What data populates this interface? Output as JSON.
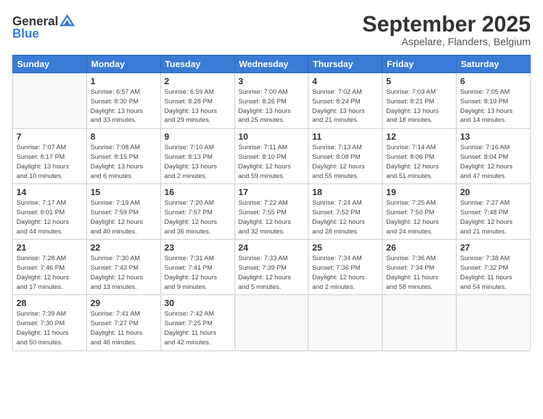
{
  "logo": {
    "general": "General",
    "blue": "Blue"
  },
  "title": "September 2025",
  "subtitle": "Aspelare, Flanders, Belgium",
  "days_of_week": [
    "Sunday",
    "Monday",
    "Tuesday",
    "Wednesday",
    "Thursday",
    "Friday",
    "Saturday"
  ],
  "weeks": [
    [
      {
        "day": "",
        "info": ""
      },
      {
        "day": "1",
        "info": "Sunrise: 6:57 AM\nSunset: 8:30 PM\nDaylight: 13 hours\nand 33 minutes."
      },
      {
        "day": "2",
        "info": "Sunrise: 6:59 AM\nSunset: 8:28 PM\nDaylight: 13 hours\nand 29 minutes."
      },
      {
        "day": "3",
        "info": "Sunrise: 7:00 AM\nSunset: 8:26 PM\nDaylight: 13 hours\nand 25 minutes."
      },
      {
        "day": "4",
        "info": "Sunrise: 7:02 AM\nSunset: 8:24 PM\nDaylight: 13 hours\nand 21 minutes."
      },
      {
        "day": "5",
        "info": "Sunrise: 7:03 AM\nSunset: 8:21 PM\nDaylight: 13 hours\nand 18 minutes."
      },
      {
        "day": "6",
        "info": "Sunrise: 7:05 AM\nSunset: 8:19 PM\nDaylight: 13 hours\nand 14 minutes."
      }
    ],
    [
      {
        "day": "7",
        "info": "Sunrise: 7:07 AM\nSunset: 8:17 PM\nDaylight: 13 hours\nand 10 minutes."
      },
      {
        "day": "8",
        "info": "Sunrise: 7:08 AM\nSunset: 8:15 PM\nDaylight: 13 hours\nand 6 minutes."
      },
      {
        "day": "9",
        "info": "Sunrise: 7:10 AM\nSunset: 8:13 PM\nDaylight: 13 hours\nand 2 minutes."
      },
      {
        "day": "10",
        "info": "Sunrise: 7:11 AM\nSunset: 8:10 PM\nDaylight: 12 hours\nand 59 minutes."
      },
      {
        "day": "11",
        "info": "Sunrise: 7:13 AM\nSunset: 8:08 PM\nDaylight: 12 hours\nand 55 minutes."
      },
      {
        "day": "12",
        "info": "Sunrise: 7:14 AM\nSunset: 8:06 PM\nDaylight: 12 hours\nand 51 minutes."
      },
      {
        "day": "13",
        "info": "Sunrise: 7:16 AM\nSunset: 8:04 PM\nDaylight: 12 hours\nand 47 minutes."
      }
    ],
    [
      {
        "day": "14",
        "info": "Sunrise: 7:17 AM\nSunset: 8:01 PM\nDaylight: 12 hours\nand 44 minutes."
      },
      {
        "day": "15",
        "info": "Sunrise: 7:19 AM\nSunset: 7:59 PM\nDaylight: 12 hours\nand 40 minutes."
      },
      {
        "day": "16",
        "info": "Sunrise: 7:20 AM\nSunset: 7:57 PM\nDaylight: 12 hours\nand 36 minutes."
      },
      {
        "day": "17",
        "info": "Sunrise: 7:22 AM\nSunset: 7:55 PM\nDaylight: 12 hours\nand 32 minutes."
      },
      {
        "day": "18",
        "info": "Sunrise: 7:24 AM\nSunset: 7:52 PM\nDaylight: 12 hours\nand 28 minutes."
      },
      {
        "day": "19",
        "info": "Sunrise: 7:25 AM\nSunset: 7:50 PM\nDaylight: 12 hours\nand 24 minutes."
      },
      {
        "day": "20",
        "info": "Sunrise: 7:27 AM\nSunset: 7:48 PM\nDaylight: 12 hours\nand 21 minutes."
      }
    ],
    [
      {
        "day": "21",
        "info": "Sunrise: 7:28 AM\nSunset: 7:46 PM\nDaylight: 12 hours\nand 17 minutes."
      },
      {
        "day": "22",
        "info": "Sunrise: 7:30 AM\nSunset: 7:43 PM\nDaylight: 12 hours\nand 13 minutes."
      },
      {
        "day": "23",
        "info": "Sunrise: 7:31 AM\nSunset: 7:41 PM\nDaylight: 12 hours\nand 9 minutes."
      },
      {
        "day": "24",
        "info": "Sunrise: 7:33 AM\nSunset: 7:39 PM\nDaylight: 12 hours\nand 5 minutes."
      },
      {
        "day": "25",
        "info": "Sunrise: 7:34 AM\nSunset: 7:36 PM\nDaylight: 12 hours\nand 2 minutes."
      },
      {
        "day": "26",
        "info": "Sunrise: 7:36 AM\nSunset: 7:34 PM\nDaylight: 11 hours\nand 58 minutes."
      },
      {
        "day": "27",
        "info": "Sunrise: 7:38 AM\nSunset: 7:32 PM\nDaylight: 11 hours\nand 54 minutes."
      }
    ],
    [
      {
        "day": "28",
        "info": "Sunrise: 7:39 AM\nSunset: 7:30 PM\nDaylight: 11 hours\nand 50 minutes."
      },
      {
        "day": "29",
        "info": "Sunrise: 7:41 AM\nSunset: 7:27 PM\nDaylight: 11 hours\nand 46 minutes."
      },
      {
        "day": "30",
        "info": "Sunrise: 7:42 AM\nSunset: 7:25 PM\nDaylight: 11 hours\nand 42 minutes."
      },
      {
        "day": "",
        "info": ""
      },
      {
        "day": "",
        "info": ""
      },
      {
        "day": "",
        "info": ""
      },
      {
        "day": "",
        "info": ""
      }
    ]
  ]
}
